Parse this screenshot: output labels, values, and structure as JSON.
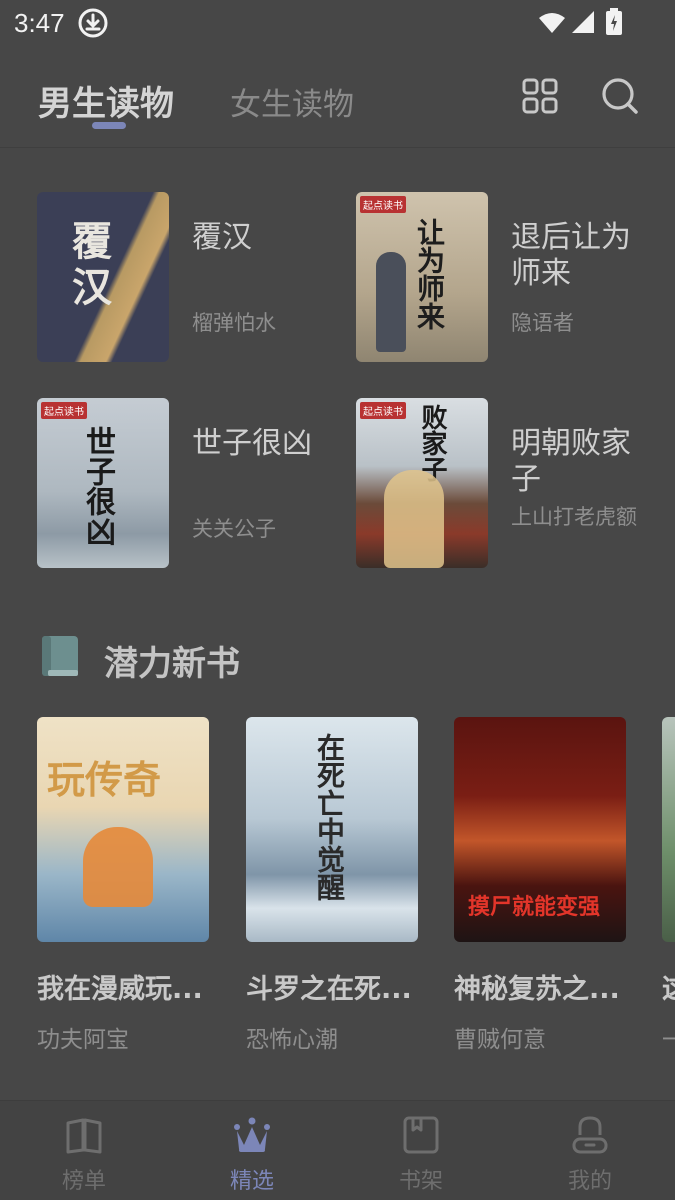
{
  "status_bar": {
    "time": "3:47"
  },
  "header": {
    "tabs": [
      {
        "label": "男生读物",
        "active": true
      },
      {
        "label": "女生读物",
        "active": false
      }
    ],
    "accent_color": "#7c86b8"
  },
  "featured": [
    {
      "title": "覆汉",
      "author": "榴弹怕水",
      "cover_text": "覆汉"
    },
    {
      "title": "退后让为师来",
      "author": "隐语者",
      "cover_text": "让为师来",
      "cover_badge": "起点读书"
    },
    {
      "title": "世子很凶",
      "author": "关关公子",
      "cover_text": "世子很凶",
      "cover_badge": "起点读书"
    },
    {
      "title": "明朝败家子",
      "author": "上山打老虎额",
      "cover_text": "败家子",
      "cover_badge": "起点读书"
    }
  ],
  "section": {
    "title": "潜力新书",
    "icon": "book-icon"
  },
  "new_books": [
    {
      "title": "我在漫威玩...",
      "author": "功夫阿宝",
      "cover_text": "玩传奇"
    },
    {
      "title": "斗罗之在死...",
      "author": "恐怖心潮",
      "cover_text": "在死亡中觉醒"
    },
    {
      "title": "神秘复苏之...",
      "author": "曹贼何意",
      "cover_text": "摸尸就能变强"
    },
    {
      "title": "这",
      "author": "一"
    }
  ],
  "bottom_nav": [
    {
      "label": "榜单",
      "icon": "open-book-icon",
      "active": false
    },
    {
      "label": "精选",
      "icon": "crown-icon",
      "active": true
    },
    {
      "label": "书架",
      "icon": "bookshelf-icon",
      "active": false
    },
    {
      "label": "我的",
      "icon": "profile-icon",
      "active": false
    }
  ]
}
